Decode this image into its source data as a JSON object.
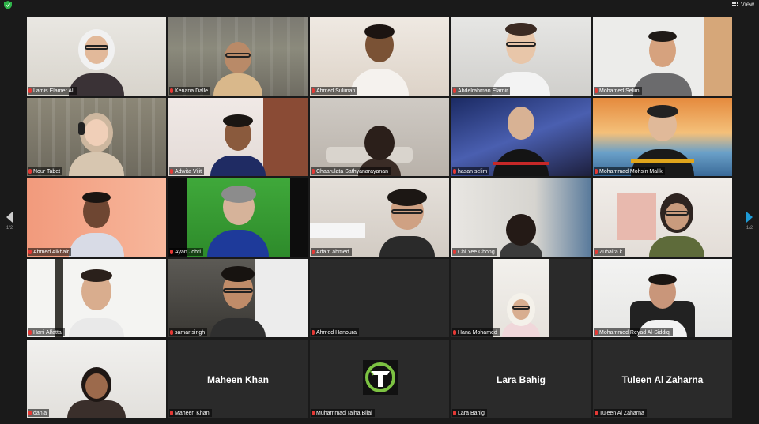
{
  "topbar": {
    "view_label": "View"
  },
  "pagination": {
    "left": "1/2",
    "right": "1/2"
  },
  "accent": "#c7e246",
  "tiles": [
    {
      "name": "Lamis Elamer Ali"
    },
    {
      "name": "Kenana Dalle"
    },
    {
      "name": "Ahmed Suliman"
    },
    {
      "name": "Abdelrahman Elamir"
    },
    {
      "name": "Mohamed Selim"
    },
    {
      "name": "Nour Tabet"
    },
    {
      "name": "Adwita Vijit"
    },
    {
      "name": "Chaarulata Sathyanarayanan"
    },
    {
      "name": "hasan selim"
    },
    {
      "name": "Mohammad Mohsin Malik"
    },
    {
      "name": "Ahmed Alkhair"
    },
    {
      "name": "Ayan Johri"
    },
    {
      "name": "Adam ahmed"
    },
    {
      "name": "Chi Yee Chong"
    },
    {
      "name": "Zuhaira k"
    },
    {
      "name": "Hani Alfattal"
    },
    {
      "name": "samar singh"
    },
    {
      "name": "Ahmed Hanoura"
    },
    {
      "name": "Hana Mohamed"
    },
    {
      "name": "Mohammed Reyad Al-Siddiqi"
    },
    {
      "name": "dania"
    },
    {
      "name": "Maheen Khan",
      "display": "Maheen Khan"
    },
    {
      "name": "Muhammad Talha Bilal"
    },
    {
      "name": "Lara Bahig",
      "display": "Lara Bahig"
    },
    {
      "name": "Tuleen Al Zaharna",
      "display": "Tuleen Al Zaharna"
    }
  ]
}
